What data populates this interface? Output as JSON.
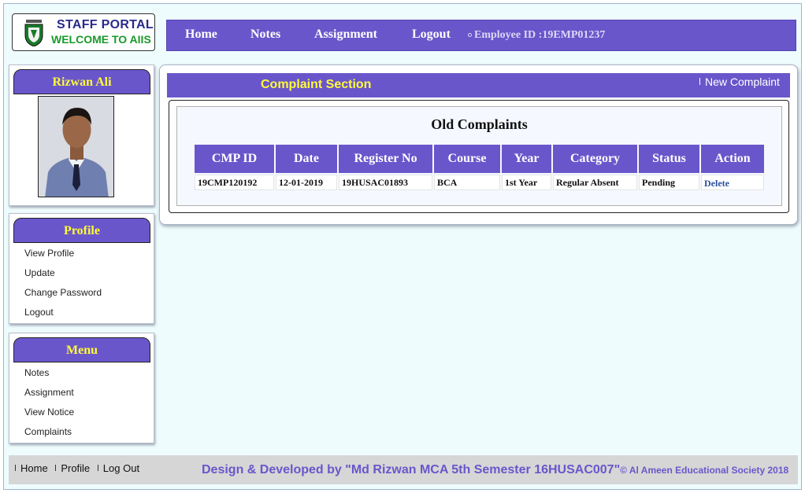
{
  "logo": {
    "line1": "STAFF PORTAL",
    "line2": "WELCOME TO AIIS"
  },
  "nav": {
    "links": [
      "Home",
      "Notes",
      "Assignment",
      "Logout"
    ],
    "employee_id": "Employee ID :19EMP01237"
  },
  "profile_box": {
    "name": "Rizwan Ali"
  },
  "profile_menu": {
    "title": "Profile",
    "items": [
      "View Profile",
      "Update",
      "Change Password",
      "Logout"
    ]
  },
  "side_menu": {
    "title": "Menu",
    "items": [
      "Notes",
      "Assignment",
      "View Notice",
      "Complaints"
    ]
  },
  "complaints": {
    "section_title": "Complaint Section",
    "new_link": "New Complaint",
    "table_title": "Old Complaints",
    "columns": [
      "CMP ID",
      "Date",
      "Register No",
      "Course",
      "Year",
      "Category",
      "Status",
      "Action"
    ],
    "rows": [
      {
        "cmp_id": "19CMP120192",
        "date": "12-01-2019",
        "register_no": "19HUSAC01893",
        "course": "BCA",
        "year": "1st Year",
        "category": "Regular Absent",
        "status": "Pending",
        "action": "Delete"
      }
    ]
  },
  "footer": {
    "links": [
      "Home",
      "Profile",
      "Log Out"
    ],
    "credit": "Design & Developed by \"Md Rizwan MCA 5th Semester 16HUSAC007\"",
    "copyright": "© Al Ameen Educational Society 2018"
  },
  "colors": {
    "accent": "#6a56cb",
    "heading_yellow": "#fffb3a",
    "page_bg": "#effcfd",
    "logo_green": "#1a9a2a"
  }
}
